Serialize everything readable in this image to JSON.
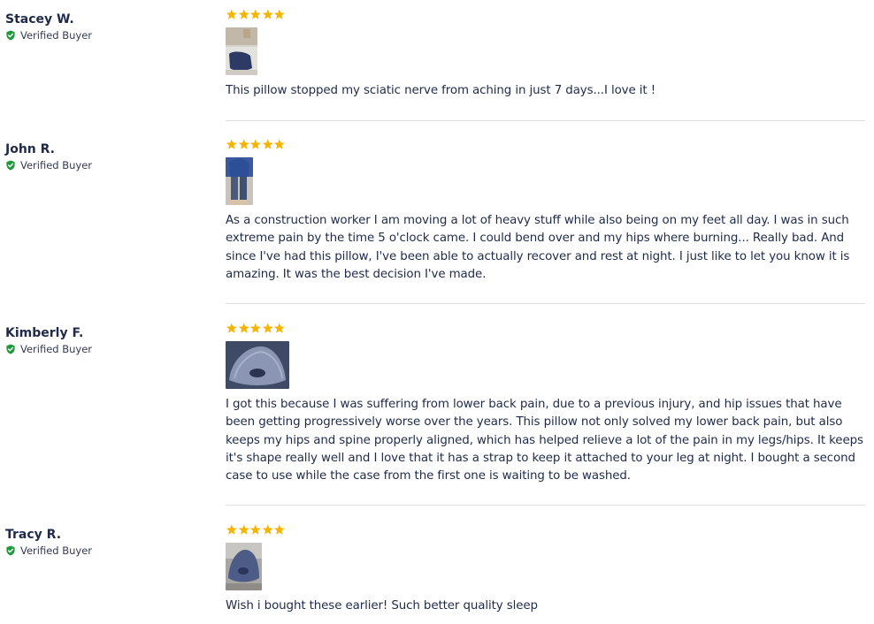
{
  "reviews": [
    {
      "author": "Stacey W.",
      "badge": "Verified Buyer",
      "rating": 5,
      "text": "This pillow stopped my sciatic nerve from aching in just 7 days...I love it !"
    },
    {
      "author": "John R.",
      "badge": "Verified Buyer",
      "rating": 5,
      "text": "As a construction worker I am moving a lot of heavy stuff while also being on my feet all day. I was in such extreme pain by the time 5 o'clock came. I could bend over and my hips where burning... Really bad. And since I've had this pillow, I've been able to actually recover and rest at night. I just like to let you know it is amazing. It was the best decision I've made."
    },
    {
      "author": "Kimberly F.",
      "badge": "Verified Buyer",
      "rating": 5,
      "text": "I got this because I was suffering from lower back pain, due to a previous injury, and hip issues that have been getting progressively worse over the years. This pillow not only solved my lower back pain, but also keeps my hips and spine properly aligned, which has helped relieve a lot of the pain in my legs/hips. It keeps it's shape really well and I love that it has a strap to keep it attached to your leg at night. I bought a second case to use while the case from the first one is waiting to be washed."
    },
    {
      "author": "Tracy R.",
      "badge": "Verified Buyer",
      "rating": 5,
      "text": "Wish i bought these earlier! Such better quality sleep"
    }
  ],
  "colors": {
    "star": "#f5b400",
    "verified": "#1f9a3a",
    "text": "#1f2a4a",
    "divider": "#dedede"
  },
  "icons": {
    "rating": "star-icon",
    "verified": "check-shield-icon"
  }
}
